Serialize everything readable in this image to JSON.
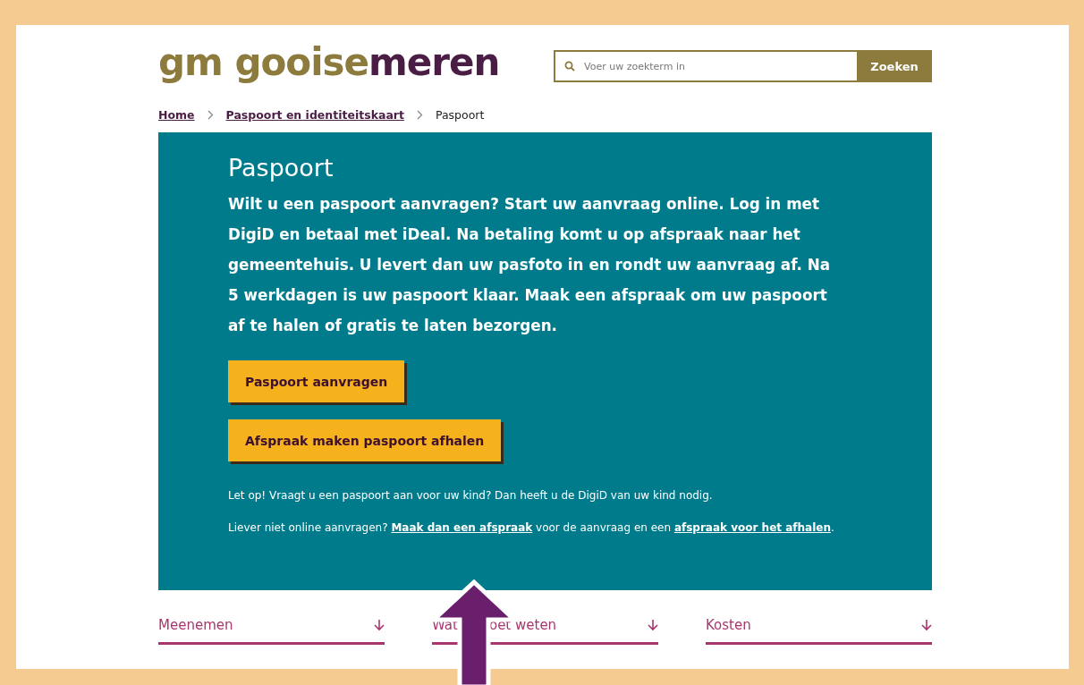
{
  "logo": {
    "parts": [
      {
        "text": "gm gooise",
        "color": "#8c7b3c"
      },
      {
        "text": "meren",
        "color": "#4a1d45"
      }
    ]
  },
  "search": {
    "placeholder": "Voer uw zoekterm in",
    "button": "Zoeken"
  },
  "breadcrumb": [
    {
      "label": "Home",
      "link": true
    },
    {
      "label": "Paspoort en identiteitskaart",
      "link": true
    },
    {
      "label": "Paspoort",
      "link": false
    }
  ],
  "intro": {
    "title": "Paspoort",
    "text": "Wilt u een paspoort aanvragen? Start uw aanvraag online. Log in met DigiD en betaal met iDeal. Na betaling komt u op afspraak naar het gemeentehuis. U levert dan uw pasfoto in en rondt uw aanvraag af. Na 5 werkdagen is uw paspoort klaar. Maak een afspraak om uw paspoort af te halen of gratis te laten bezorgen.",
    "buttons": [
      "Paspoort aanvragen",
      "Afspraak maken paspoort afhalen"
    ],
    "note": "Let op! Vraagt u een paspoort aan voor uw kind? Dan heeft u de DigiD van uw kind nodig.",
    "alt_text": [
      {
        "text": "Liever niet online aanvragen? ",
        "link": false
      },
      {
        "text": "Maak dan een afspraak",
        "link": true
      },
      {
        "text": " voor de aanvraag en een ",
        "link": false
      },
      {
        "text": "afspraak voor het afhalen",
        "link": true
      },
      {
        "text": ".",
        "link": false
      }
    ]
  },
  "accordion": [
    {
      "label_parts": [
        "Meenemen"
      ],
      "expanded": false
    },
    {
      "label_parts": [
        "Wat",
        "oet weten"
      ],
      "expanded": false
    },
    {
      "label_parts": [
        "Kosten"
      ],
      "expanded": false
    }
  ]
}
